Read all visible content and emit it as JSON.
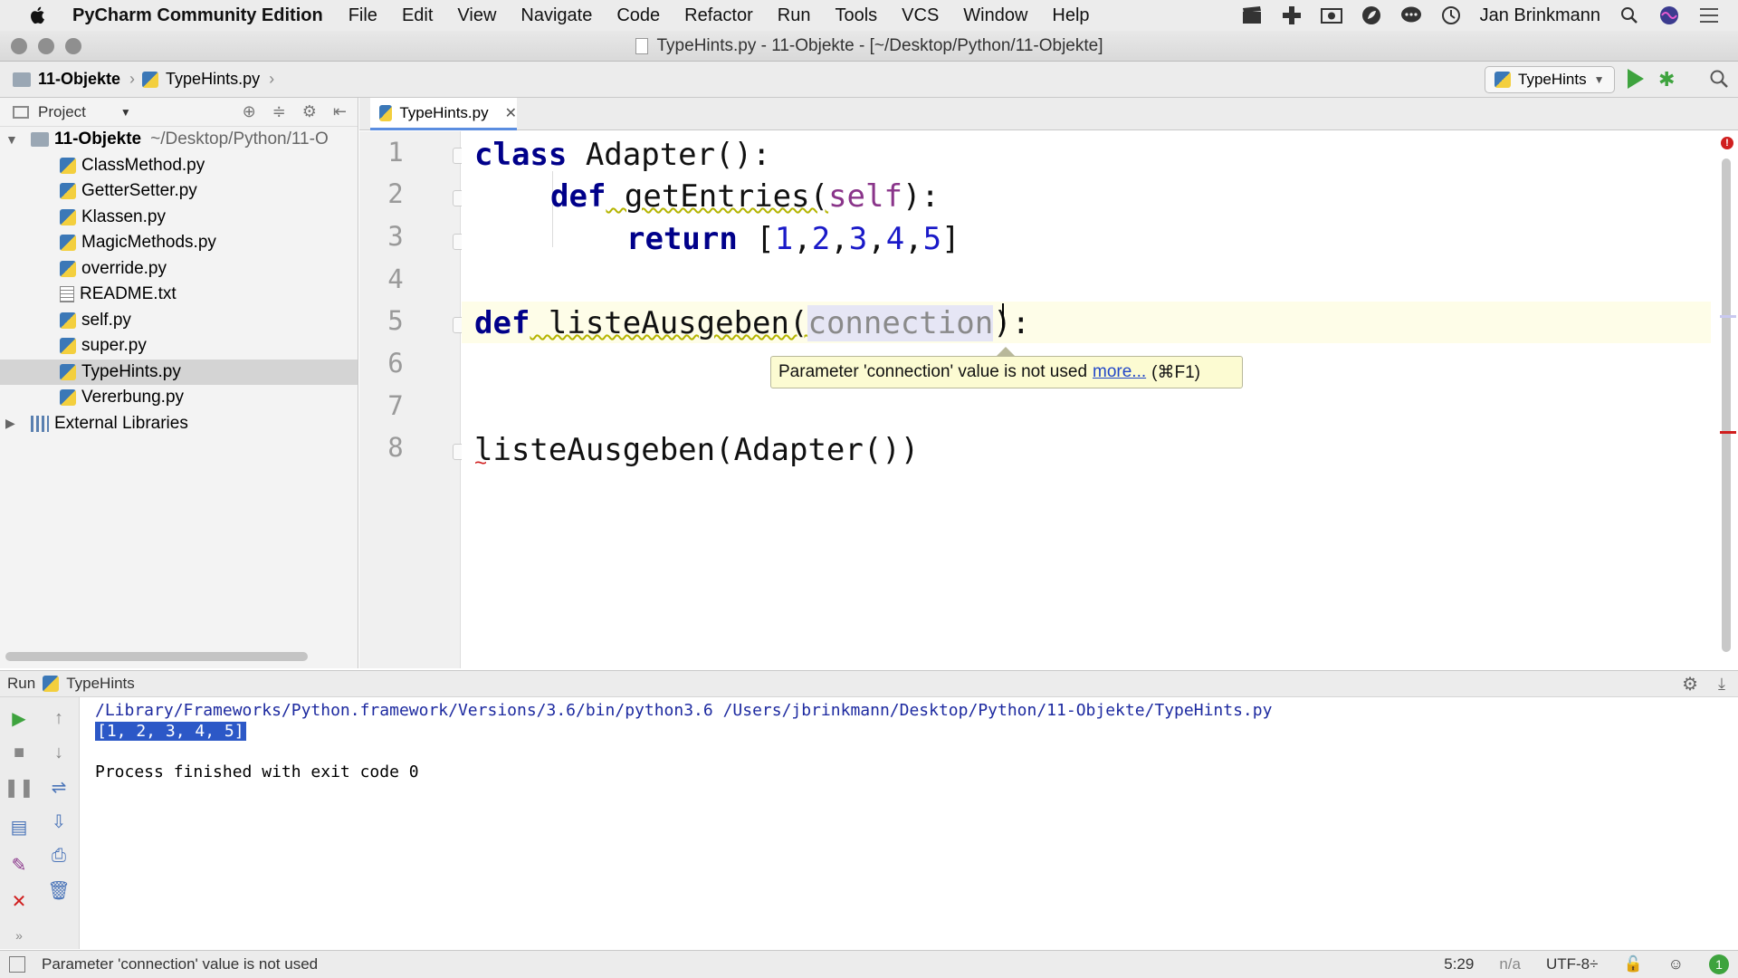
{
  "menubar": {
    "app_name": "PyCharm Community Edition",
    "items": [
      "File",
      "Edit",
      "View",
      "Navigate",
      "Code",
      "Refactor",
      "Run",
      "Tools",
      "VCS",
      "Window",
      "Help"
    ],
    "user": "Jan Brinkmann"
  },
  "window": {
    "title": "TypeHints.py - 11-Objekte - [~/Desktop/Python/11-Objekte]"
  },
  "breadcrumb": {
    "project": "11-Objekte",
    "file": "TypeHints.py"
  },
  "run_config": {
    "label": "TypeHints"
  },
  "project_panel": {
    "header": "Project",
    "root": {
      "label": "11-Objekte",
      "path": "~/Desktop/Python/11-O"
    },
    "files": [
      {
        "label": "ClassMethod.py",
        "type": "py"
      },
      {
        "label": "GetterSetter.py",
        "type": "py"
      },
      {
        "label": "Klassen.py",
        "type": "py"
      },
      {
        "label": "MagicMethods.py",
        "type": "py"
      },
      {
        "label": "override.py",
        "type": "py"
      },
      {
        "label": "README.txt",
        "type": "txt"
      },
      {
        "label": "self.py",
        "type": "py"
      },
      {
        "label": "super.py",
        "type": "py"
      },
      {
        "label": "TypeHints.py",
        "type": "py",
        "selected": true
      },
      {
        "label": "Vererbung.py",
        "type": "py"
      }
    ],
    "external": "External Libraries"
  },
  "editor": {
    "tab": "TypeHints.py",
    "line_numbers": [
      "1",
      "2",
      "3",
      "4",
      "5",
      "6",
      "7",
      "8"
    ],
    "code": {
      "l1_kw": "class",
      "l1_rest": " Adapter():",
      "l2_kw": "def",
      "l2_name": " getEntries(",
      "l2_self": "self",
      "l2_end": "):",
      "l3_kw": "return",
      "l3_open": " [",
      "l3_n1": "1",
      "l3_n2": "2",
      "l3_n3": "3",
      "l3_n4": "4",
      "l3_n5": "5",
      "l3_close": "]",
      "l5_kw": "def",
      "l5_name": " listeAusgeben(",
      "l5_param": "connection",
      "l5_end": "):",
      "l8": "listeAusgeben(Adapter())"
    },
    "tooltip": {
      "text": "Parameter 'connection' value is not used",
      "link": "more...",
      "shortcut": "(⌘F1)"
    }
  },
  "run_panel": {
    "label": "Run",
    "config": "TypeHints",
    "console": {
      "command": "/Library/Frameworks/Python.framework/Versions/3.6/bin/python3.6 /Users/jbrinkmann/Desktop/Python/11-Objekte/TypeHints.py",
      "output": "[1, 2, 3, 4, 5]",
      "exit": "Process finished with exit code 0"
    }
  },
  "statusbar": {
    "message": "Parameter 'connection' value is not used",
    "position": "5:29",
    "na": "n/a",
    "encoding": "UTF-8÷",
    "badge": "1"
  }
}
